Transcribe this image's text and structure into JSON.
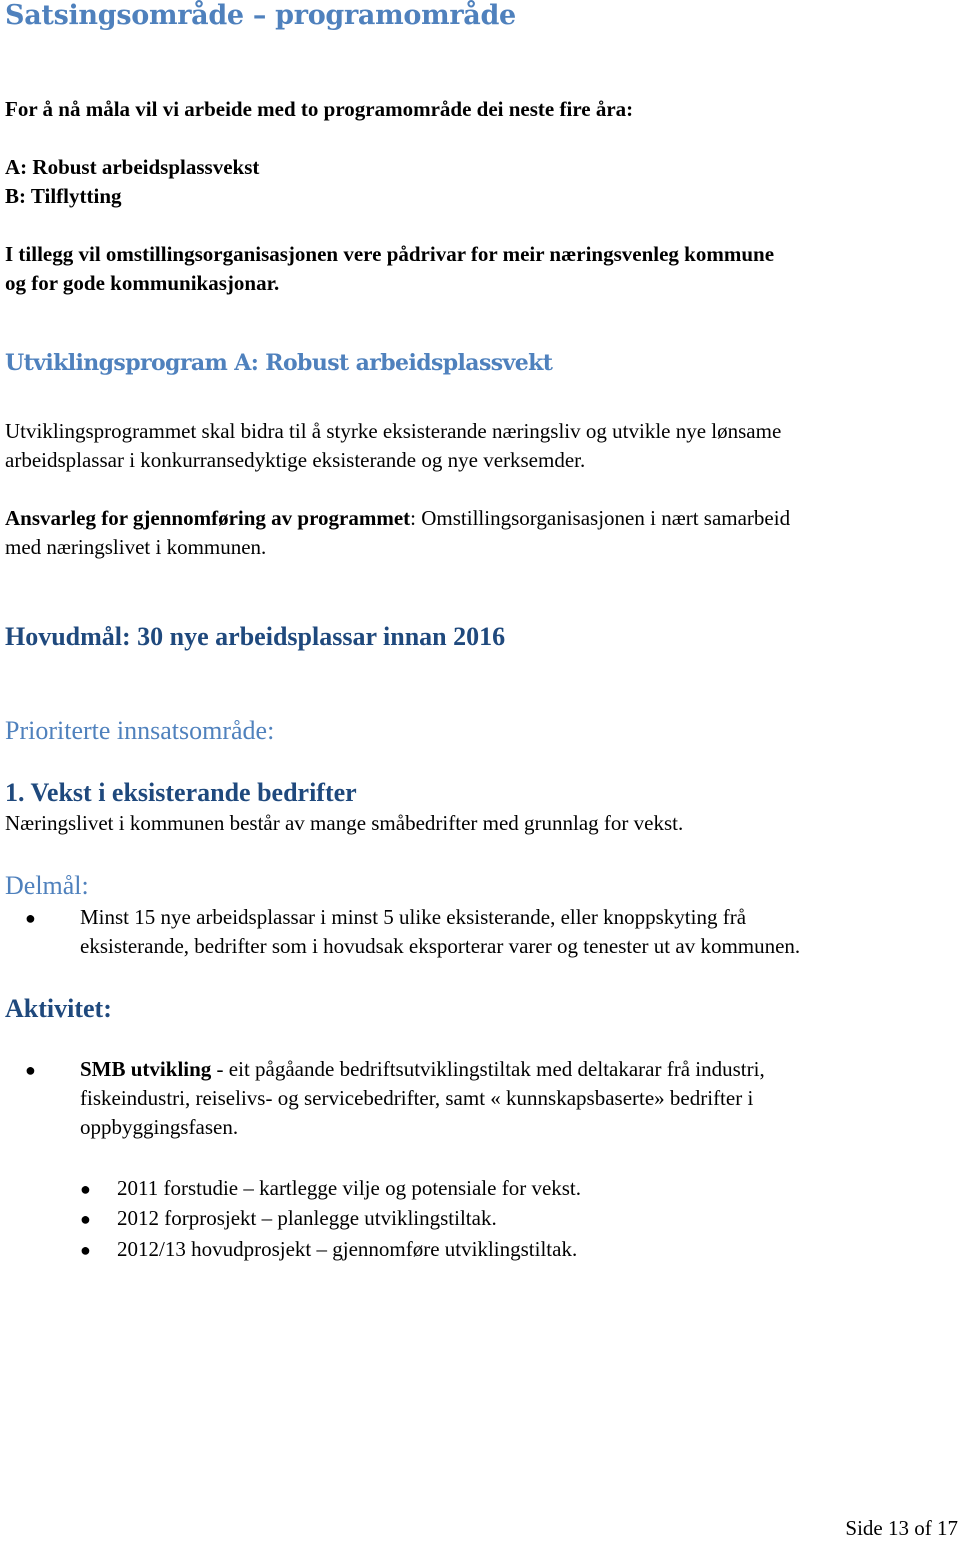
{
  "title": "Satsingsområde – programområde",
  "intro": {
    "lead": "For å nå måla vil vi arbeide med to programområde dei neste fire åra:",
    "areas": [
      "A: Robust arbeidsplassvekst",
      "B: Tilflytting"
    ],
    "addition_line1": "I tillegg vil omstillingsorganisasjonen vere pådrivar for meir næringsvenleg kommune",
    "addition_line2": "og for gode kommunikasjonar."
  },
  "program_a": {
    "heading": "Utviklingsprogram A:  Robust arbeidsplassvekt",
    "description_line1": "Utviklingsprogrammet skal bidra til å styrke eksisterande næringsliv og utvikle nye lønsame",
    "description_line2": "arbeidsplassar i konkurransedyktige eksisterande og nye verksemder.",
    "responsible_label": "Ansvarleg for gjennomføring av programmet",
    "responsible_text": ": Omstillingsorganisasjonen i nært samarbeid",
    "responsible_line2": "med næringslivet i kommunen.",
    "main_goal": "Hovudmål: 30 nye arbeidsplassar innan 2016",
    "priority_heading": "Prioriterte innsatsområde:"
  },
  "focus_area_1": {
    "heading": "1.  Vekst i eksisterande bedrifter",
    "description": "Næringslivet i kommunen består av mange småbedrifter med grunnlag for vekst.",
    "subgoal_heading": "Delmål:",
    "subgoals": [
      {
        "line1": "Minst 15 nye arbeidsplassar i minst 5 ulike eksisterande, eller knoppskyting frå",
        "line2": "eksisterande, bedrifter som i hovudsak eksporterar varer og tenester ut av kommunen."
      }
    ],
    "activity_heading": "Aktivitet:",
    "activity": {
      "title": "SMB utvikling",
      "line1": " - eit pågåande bedriftsutviklingstiltak med deltakarar frå industri,",
      "line2": "fiskeindustri, reiselivs- og servicebedrifter, samt « kunnskapsbaserte» bedrifter i",
      "line3": "oppbyggingsfasen.",
      "phases": [
        "2011 forstudie – kartlegge vilje og potensiale for vekst.",
        "2012 forprosjekt – planlegge utviklingstiltak.",
        "2012/13 hovudprosjekt – gjennomføre utviklingstiltak."
      ]
    }
  },
  "footer": {
    "page_label": "Side 13 of 17"
  },
  "colors": {
    "heading_blue": "#4f81bd",
    "heading_navy": "#1f497d"
  }
}
